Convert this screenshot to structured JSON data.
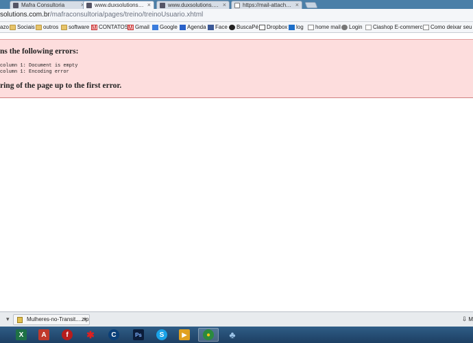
{
  "browser": {
    "tabs": [
      {
        "title": "Mafra Consultoria",
        "active": false
      },
      {
        "title": "www.duxsolutions.com.br",
        "active": true
      },
      {
        "title": "www.duxsolutions.com.br",
        "active": false
      },
      {
        "title": "https://mail-attachment.g",
        "active": false
      }
    ],
    "address": {
      "host": "solutions.com.br",
      "path": "/mafraconsultoria/pages/treino/treinoUsuario.xhtml"
    },
    "bookmarks": [
      {
        "label": "azo",
        "icon": "folder-icon"
      },
      {
        "label": "Sociais",
        "icon": "folder-icon"
      },
      {
        "label": "outros",
        "icon": "folder-icon"
      },
      {
        "label": "software",
        "icon": "folder-icon"
      },
      {
        "label": "CONTATOS",
        "icon": "gmail-icon"
      },
      {
        "label": "Gmail",
        "icon": "gmail-icon"
      },
      {
        "label": "Google",
        "icon": "google-icon"
      },
      {
        "label": "Agenda",
        "icon": "calendar-icon"
      },
      {
        "label": "Face",
        "icon": "facebook-icon"
      },
      {
        "label": "BuscaPé",
        "icon": "buscape-icon"
      },
      {
        "label": "Dropbox",
        "icon": "dropbox-icon"
      },
      {
        "label": "log",
        "icon": "log-icon"
      },
      {
        "label": "home mail",
        "icon": "page-icon"
      },
      {
        "label": "Login",
        "icon": "login-icon"
      },
      {
        "label": "Ciashop E-commerc...",
        "icon": "ciashop-icon"
      },
      {
        "label": "Como deixar seu na...",
        "icon": "page-icon"
      }
    ]
  },
  "error": {
    "heading": "ns the following errors:",
    "lines": [
      "column 1: Document is empty",
      "column 1: Encoding error"
    ],
    "footer": "ring of the page up to the first error."
  },
  "downloads": {
    "file": "Mulheres-no-Transit....zip",
    "show_all": "M"
  },
  "taskbar": {
    "apps": [
      {
        "name": "excel",
        "color": "#1e7145",
        "glyph": "X"
      },
      {
        "name": "pdf",
        "color": "#c0392b",
        "glyph": "A"
      },
      {
        "name": "filezilla",
        "color": "#b71c1c",
        "glyph": "f"
      },
      {
        "name": "spider",
        "color": "#cc1111",
        "glyph": "✱"
      },
      {
        "name": "c-app",
        "color": "#0a3f78",
        "glyph": "C"
      },
      {
        "name": "photoshop",
        "color": "#0b1d3a",
        "glyph": "Ps"
      },
      {
        "name": "skype",
        "color": "#1aa3e8",
        "glyph": "S"
      },
      {
        "name": "media-player",
        "color": "#e0a020",
        "glyph": "▶"
      },
      {
        "name": "chrome",
        "color": "#2b8a3e",
        "glyph": "●"
      },
      {
        "name": "network",
        "color": "#5b8fbf",
        "glyph": "♣"
      }
    ]
  }
}
